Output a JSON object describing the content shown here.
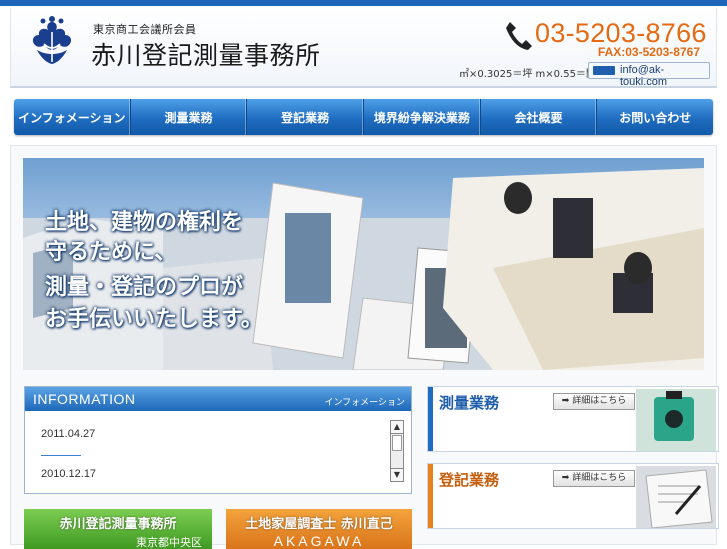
{
  "header": {
    "member_label": "東京商工会議所会員",
    "company_name": "赤川登記測量事務所",
    "phone": "03-5203-8766",
    "fax": "FAX:03-5203-8767",
    "conversion": "㎡×0.3025＝坪 m×0.55＝間",
    "email": "info@ak-touki.com"
  },
  "nav": {
    "items": [
      {
        "label": "インフォメーション"
      },
      {
        "label": "測量業務"
      },
      {
        "label": "登記業務"
      },
      {
        "label": "境界紛争解決業務"
      },
      {
        "label": "会社概要"
      },
      {
        "label": "お問い合わせ"
      }
    ]
  },
  "hero": {
    "lines": [
      "土地、建物の権利を",
      "守るために、",
      "測量・登記のプロが",
      "お手伝いいたします。"
    ]
  },
  "info": {
    "title": "INFORMATION",
    "subtitle": "インフォメーション",
    "entries": [
      {
        "date": "2011.04.27"
      },
      {
        "date": "2010.12.17"
      }
    ]
  },
  "services": [
    {
      "title": "測量業務",
      "button": "➡ 詳細はこちら",
      "color": "#1f6cc0"
    },
    {
      "title": "登記業務",
      "button": "➡ 詳細はこちら",
      "color": "#e8821e"
    }
  ],
  "bottom": {
    "left_title": "赤川登記測量事務所",
    "left_sub": "東京都中央区",
    "right_title": "土地家屋調査士 赤川直己",
    "right_sub": "AKAGAWA"
  },
  "colors": {
    "accent": "#1f66b8",
    "phone": "#e56a12",
    "green": "#4fae2c",
    "orange": "#e8821e"
  }
}
